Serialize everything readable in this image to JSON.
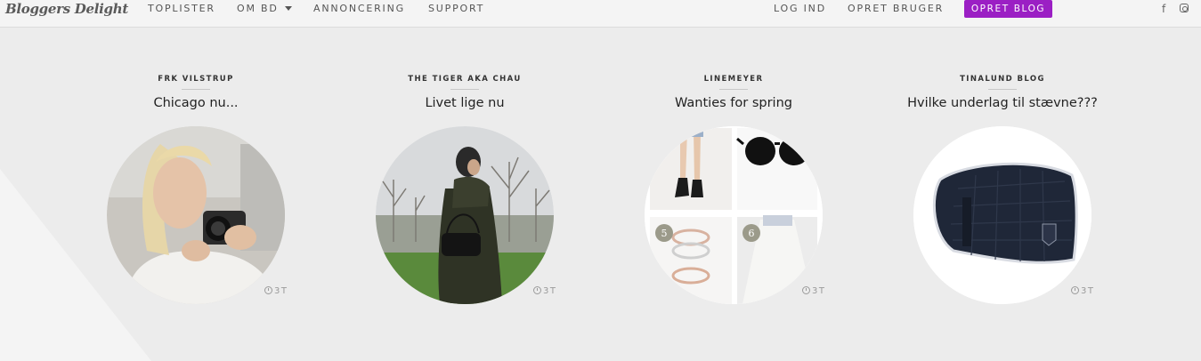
{
  "header": {
    "logo_text": "Bloggers Delight",
    "nav": {
      "toplister": "TOPLISTER",
      "om_bd": "OM BD",
      "annoncering": "ANNONCERING",
      "support": "SUPPORT"
    },
    "account": {
      "login": "LOG IND",
      "register": "OPRET BRUGER",
      "create_blog": "OPRET BLOG"
    },
    "social": {
      "facebook_glyph": "f",
      "facebook_icon": "facebook-icon",
      "instagram_icon": "instagram-icon"
    }
  },
  "colors": {
    "accent": "#9b1fc4",
    "page_bg": "#ececec",
    "topbar_bg": "#f4f4f4"
  },
  "posts": [
    {
      "blog": "FRK VILSTRUP",
      "title": "Chicago nu...",
      "age": "3T"
    },
    {
      "blog": "THE TIGER AKA CHAU",
      "title": "Livet lige nu",
      "age": "3T"
    },
    {
      "blog": "LINEMEYER",
      "title": "Wanties for spring",
      "age": "3T",
      "collage_numbers": [
        "5",
        "6"
      ]
    },
    {
      "blog": "TINALUND BLOG",
      "title": "Hvilke underlag til stævne???",
      "age": "3T"
    }
  ]
}
